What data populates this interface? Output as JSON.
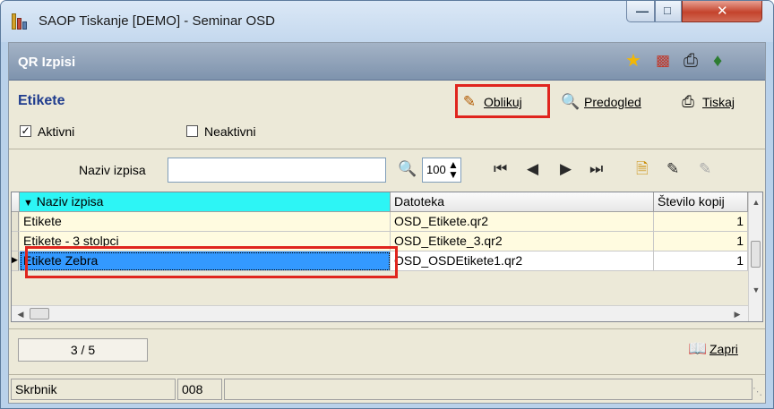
{
  "window": {
    "title": "SAOP Tiskanje [DEMO] - Seminar OSD"
  },
  "panel": {
    "title": "QR Izpisi"
  },
  "section": {
    "title": "Etikete"
  },
  "filters": {
    "active_label": "Aktivni",
    "active_checked": true,
    "inactive_label": "Neaktivni",
    "inactive_checked": false
  },
  "toolbar": {
    "design_label": "Oblikuj",
    "preview_label": "Predogled",
    "print_label": "Tiskaj"
  },
  "filterbar": {
    "name_label": "Naziv izpisa",
    "name_value": "",
    "zoom_value": "100"
  },
  "grid": {
    "columns": [
      "Naziv izpisa",
      "Datoteka",
      "Število kopij"
    ],
    "rows": [
      {
        "name": "Etikete",
        "file": "OSD_Etikete.qr2",
        "copies": "1"
      },
      {
        "name": "Etikete - 3 stolpci",
        "file": "OSD_Etikete_3.qr2",
        "copies": "1"
      },
      {
        "name": "Etikete Zebra",
        "file": "OSD_OSDEtikete1.qr2",
        "copies": "1"
      }
    ],
    "selected_row": 2
  },
  "footer": {
    "record_counter": "3 / 5",
    "close_label": "Zapri"
  },
  "status": {
    "user": "Skrbnik",
    "code": "008"
  },
  "colors": {
    "selection": "#3399ff",
    "sorted_header": "#2df5f5",
    "highlight": "#e0251e",
    "section_title": "#1f3c8e"
  }
}
